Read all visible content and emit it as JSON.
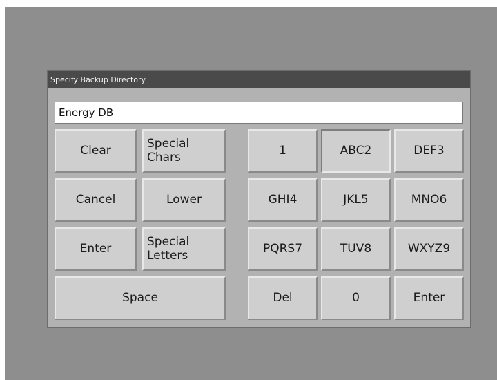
{
  "dialog": {
    "title": "Specify Backup Directory"
  },
  "text_field": {
    "value": "Energy DB"
  },
  "keys": {
    "clear": "Clear",
    "special_chars_line1": "Special",
    "special_chars_line2": "Chars",
    "cancel": "Cancel",
    "lower": "Lower",
    "enter_left": "Enter",
    "special_letters_line1": "Special",
    "special_letters_line2": "Letters",
    "space": "Space",
    "k1": "1",
    "k2": "ABC2",
    "k3": "DEF3",
    "k4": "GHI4",
    "k5": "JKL5",
    "k6": "MNO6",
    "k7": "PQRS7",
    "k8": "TUV8",
    "k9": "WXYZ9",
    "del": "Del",
    "k0": "0",
    "enter_right": "Enter"
  },
  "colors": {
    "screen_background": "#8e8e8e",
    "dialog_background": "#b2b2b2",
    "titlebar": "#4a4a4a",
    "key_face": "#cfcfcf"
  }
}
